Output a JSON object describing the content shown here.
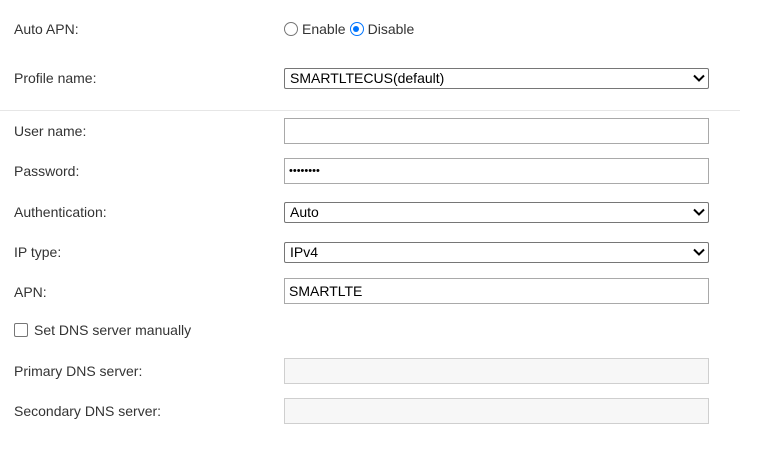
{
  "auto_apn": {
    "label": "Auto APN:",
    "options": [
      "Enable",
      "Disable"
    ],
    "selected": "Disable"
  },
  "profile": {
    "label": "Profile name:",
    "value": "SMARTLTECUS(default)"
  },
  "username": {
    "label": "User name:",
    "value": ""
  },
  "password": {
    "label": "Password:",
    "value": "••••••••"
  },
  "authentication": {
    "label": "Authentication:",
    "value": "Auto"
  },
  "ip_type": {
    "label": "IP type:",
    "value": "IPv4"
  },
  "apn": {
    "label": "APN:",
    "value": "SMARTLTE"
  },
  "dns_manual": {
    "label": "Set DNS server manually",
    "checked": false
  },
  "primary_dns": {
    "label": "Primary DNS server:",
    "value": ""
  },
  "secondary_dns": {
    "label": "Secondary DNS server:",
    "value": ""
  },
  "icons": {
    "select_arrow": "chevron-down-icon",
    "radio": "radio-icon",
    "checkbox": "checkbox-icon"
  },
  "colors": {
    "accent": "#0075ff",
    "text": "#333333",
    "border": "#a9a9a9",
    "disabled_bg": "#f7f7f7"
  }
}
